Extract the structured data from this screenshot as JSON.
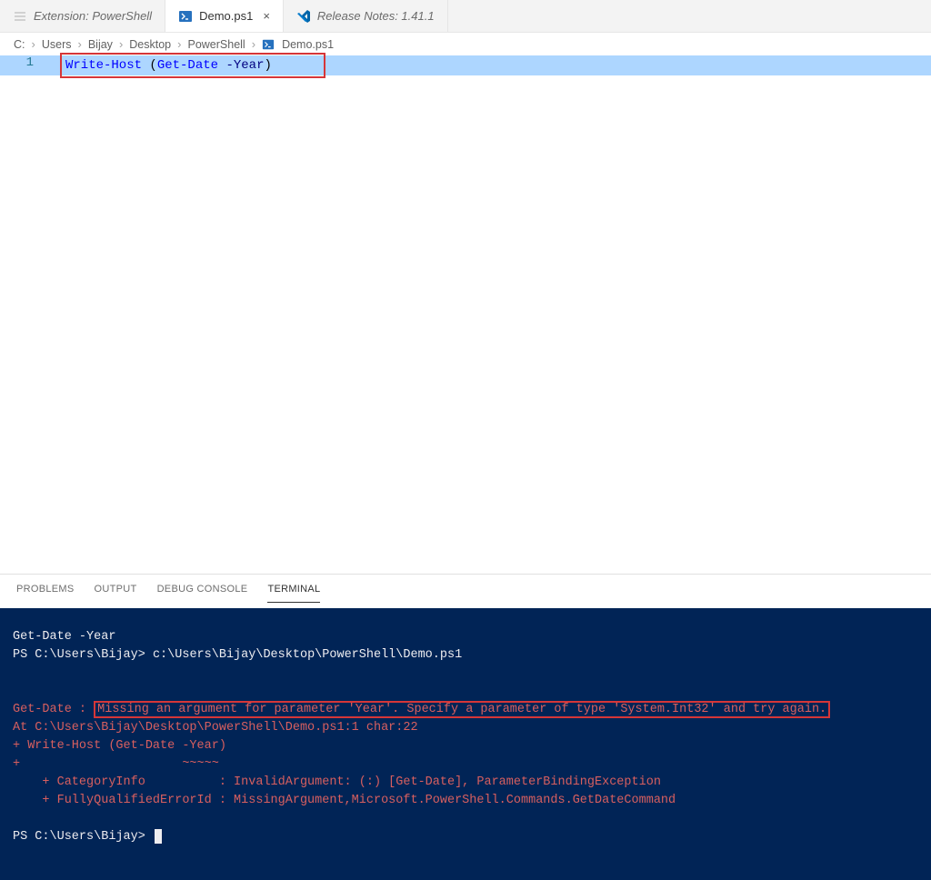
{
  "tabs": {
    "ext": "Extension: PowerShell",
    "demo": "Demo.ps1",
    "release": "Release Notes: 1.41.1"
  },
  "breadcrumb": {
    "c0": "C:",
    "c1": "Users",
    "c2": "Bijay",
    "c3": "Desktop",
    "c4": "PowerShell",
    "c5": "Demo.ps1"
  },
  "editor": {
    "lineNumber": "1",
    "tok_write": "Write-Host",
    "tok_space1": " ",
    "tok_lpar": "(",
    "tok_getdate": "Get-Date",
    "tok_space2": " ",
    "tok_dash": "-",
    "tok_year": "Year",
    "tok_rpar": ")"
  },
  "panel": {
    "problems": "PROBLEMS",
    "output": "OUTPUT",
    "debug": "DEBUG CONSOLE",
    "terminal": "TERMINAL"
  },
  "terminal": {
    "l1": "Get-Date -Year",
    "l2a": "PS C:\\Users\\Bijay> ",
    "l2b": "c:\\Users\\Bijay\\Desktop\\PowerShell\\Demo.ps1",
    "errp": "Get-Date : ",
    "errmsg": "Missing an argument for parameter 'Year'. Specify a parameter of type 'System.Int32' and try again.",
    "e2": "At C:\\Users\\Bijay\\Desktop\\PowerShell\\Demo.ps1:1 char:22",
    "e3": "+ Write-Host (Get-Date -Year)",
    "e4": "+                      ~~~~~",
    "e5": "    + CategoryInfo          : InvalidArgument: (:) [Get-Date], ParameterBindingException",
    "e6": "    + FullyQualifiedErrorId : MissingArgument,Microsoft.PowerShell.Commands.GetDateCommand",
    "prompt": "PS C:\\Users\\Bijay> "
  }
}
